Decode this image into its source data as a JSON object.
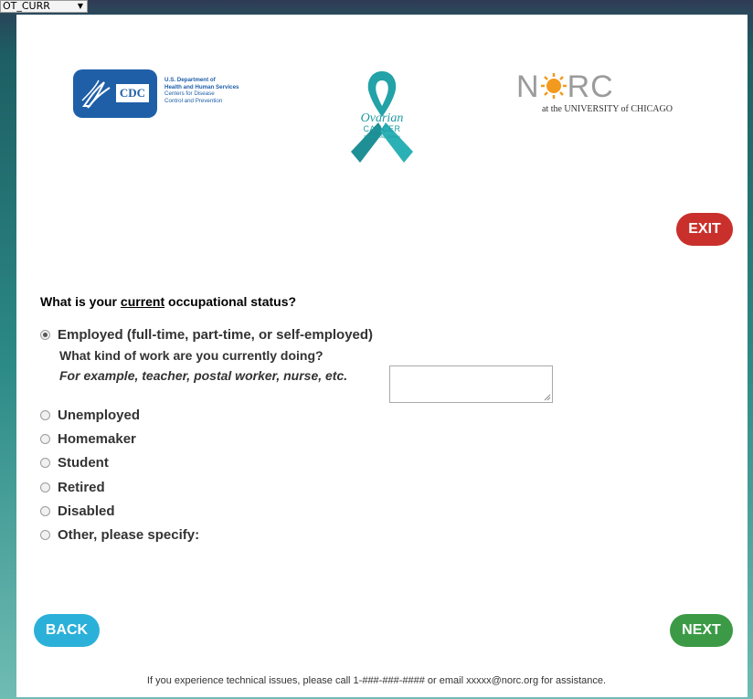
{
  "variable_select": {
    "value": "OT_CURR"
  },
  "logos": {
    "cdc": {
      "mark": "CDC",
      "agency_lines": [
        "U.S. Department of",
        "Health and Human Services",
        "Centers for Disease",
        "Control and Prevention"
      ]
    },
    "ribbon": {
      "line1": "Ovarian",
      "line2": "CANCER",
      "line3": "Survivorship Survey"
    },
    "norc": {
      "word": "NORC",
      "subtitle": "at the UNIVERSITY of CHICAGO"
    }
  },
  "buttons": {
    "exit": "EXIT",
    "back": "BACK",
    "next": "NEXT"
  },
  "question": {
    "prefix": "What is your ",
    "emphasis": "current",
    "suffix": " occupational status?"
  },
  "options": [
    {
      "label": "Employed (full-time, part-time, or self-employed)",
      "selected": true
    },
    {
      "label": "Unemployed",
      "selected": false
    },
    {
      "label": "Homemaker",
      "selected": false
    },
    {
      "label": "Student",
      "selected": false
    },
    {
      "label": "Retired",
      "selected": false
    },
    {
      "label": "Disabled",
      "selected": false
    },
    {
      "label": "Other, please specify:",
      "selected": false
    }
  ],
  "followup": {
    "question": "What kind of work are you currently doing?",
    "example": "For example, teacher, postal worker, nurse, etc.",
    "value": ""
  },
  "footer": "If you experience technical issues, please call 1-###-###-#### or email xxxxx@norc.org for assistance.",
  "colors": {
    "exit": "#c9302c",
    "back": "#2bb0d9",
    "next": "#3c9a46",
    "cdc_blue": "#1f5fa8",
    "ribbon_teal": "#1f9aa0",
    "norc_orange": "#f29a1d"
  }
}
